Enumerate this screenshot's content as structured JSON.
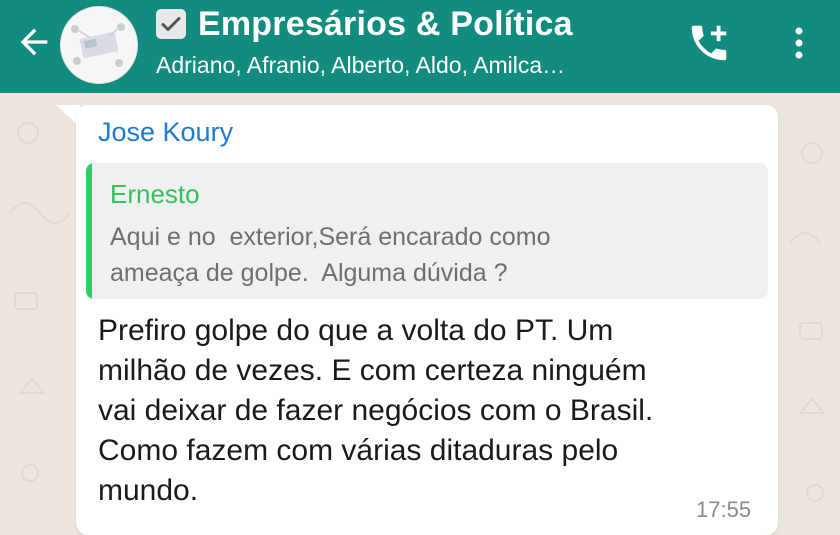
{
  "header": {
    "title": "Empresários & Política",
    "members": "Adriano, Afranio, Alberto, Aldo, Amilca…",
    "accent_color": "#128c7e",
    "icons": {
      "back": "arrow-left-icon",
      "checkbox": "checkmark-icon",
      "call": "add-call-icon",
      "menu": "more-vert-icon"
    }
  },
  "message": {
    "sender": "Jose Koury",
    "sender_color": "#1e7bd1",
    "quote": {
      "author": "Ernesto",
      "author_color": "#35c05a",
      "text": "Aqui e no  exterior,Será encarado como\nameaça de golpe.  Alguma dúvida ?"
    },
    "text": "Prefiro golpe do que a volta do PT. Um\nmilhão de vezes. E com certeza ninguém\nvai deixar de fazer negócios com o Brasil.\nComo fazem com várias ditaduras pelo\nmundo.",
    "time": "17:55"
  }
}
